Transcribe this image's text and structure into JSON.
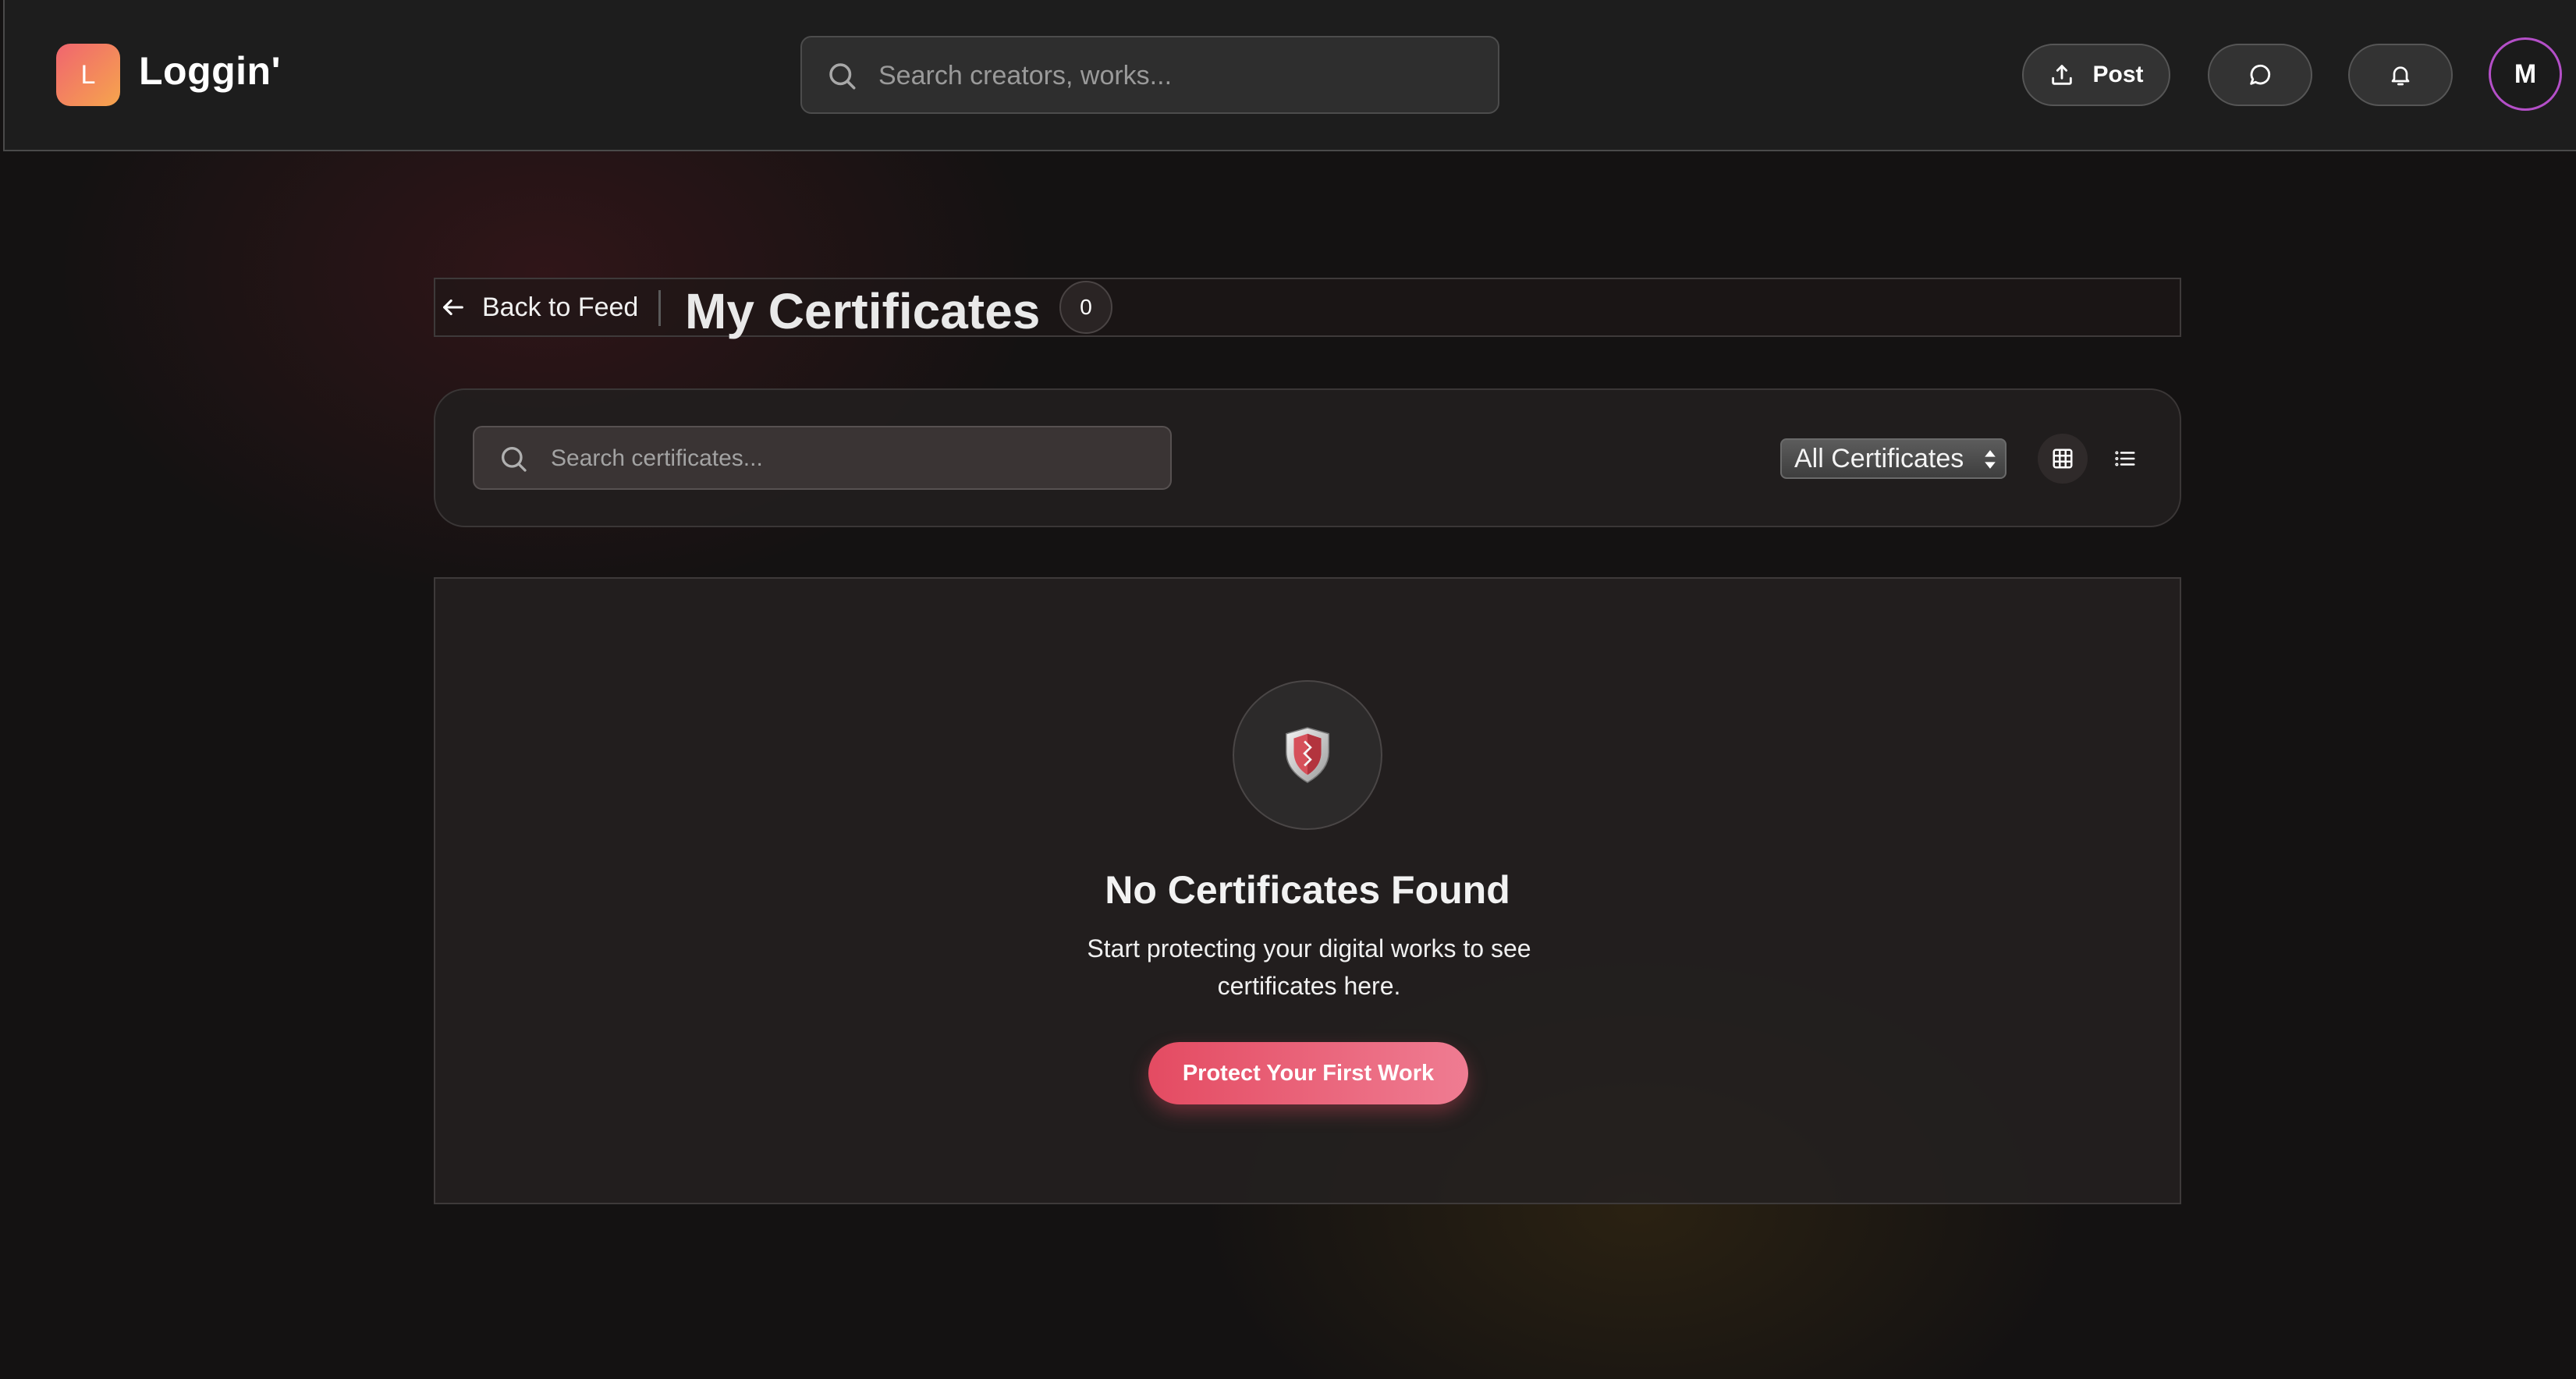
{
  "header": {
    "logo_letter": "L",
    "app_name": "Loggin'",
    "search_placeholder": "Search creators, works...",
    "post_label": "Post",
    "avatar_initial": "M",
    "icons": [
      "search-icon",
      "upload-icon",
      "message-icon",
      "bell-icon"
    ]
  },
  "titlebar": {
    "back_label": "Back to Feed",
    "title": "My Certificates",
    "count": "0"
  },
  "filters": {
    "search_placeholder": "Search certificates...",
    "select_value": "All Certificates",
    "view_modes": [
      "grid",
      "list"
    ],
    "active_view": "grid"
  },
  "empty_state": {
    "title": "No Certificates Found",
    "description": "Start protecting your digital works to see certificates here.",
    "cta_label": "Protect Your First Work",
    "icon": "shield-icon"
  },
  "colors": {
    "accent": "#e44b62",
    "logo_gradient_start": "#f0656f",
    "logo_gradient_end": "#f6a54d",
    "avatar_ring": "#b44fc8",
    "background": "#141212"
  }
}
